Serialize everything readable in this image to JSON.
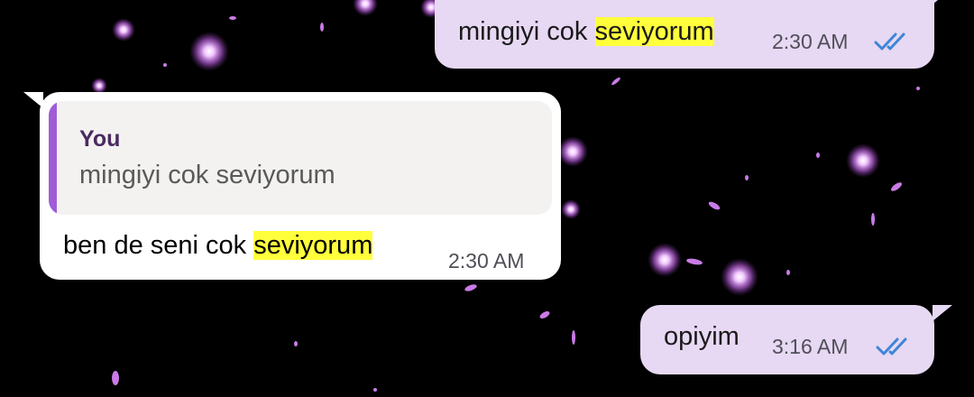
{
  "chat": {
    "messages": [
      {
        "direction": "outgoing",
        "text_plain": "mingiyi cok ",
        "text_highlight": "seviyorum",
        "time": "2:30 AM",
        "status": "read-double-check-icon"
      },
      {
        "direction": "incoming",
        "reply": {
          "author": "You",
          "text": "mingiyi cok seviyorum"
        },
        "text_plain": "ben de seni cok ",
        "text_highlight": "seviyorum",
        "time": "2:30 AM"
      },
      {
        "direction": "outgoing",
        "text_plain": "opiyim",
        "time": "3:16 AM",
        "status": "read-double-check-icon"
      }
    ]
  },
  "colors": {
    "background": "#000000",
    "outgoing_bubble": "#e7d8f3",
    "incoming_bubble": "#ffffff",
    "search_highlight": "#ffff3c",
    "read_ticks": "#3d86d8",
    "reply_accent": "#a05cd6",
    "sparkle": "#d58cf0"
  }
}
